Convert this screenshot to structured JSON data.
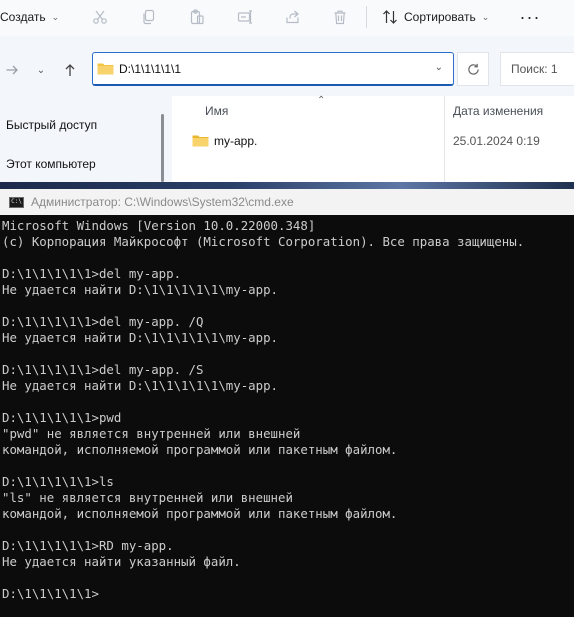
{
  "explorer": {
    "toolbar": {
      "create_label": "Создать",
      "sort_label": "Сортировать",
      "more_label": "···",
      "icons": [
        "cut-icon",
        "copy-icon",
        "paste-icon",
        "rename-icon",
        "share-icon",
        "delete-icon"
      ]
    },
    "address": {
      "path": "D:\\1\\1\\1\\1\\1"
    },
    "search": {
      "placeholder": "Поиск: 1"
    },
    "nav": {
      "items": [
        {
          "label": "Быстрый доступ"
        },
        {
          "label": "Этот компьютер"
        }
      ]
    },
    "columns": {
      "name": "Имя",
      "date": "Дата изменения"
    },
    "files": [
      {
        "name": "my-app.",
        "date": "25.01.2024 0:19"
      }
    ]
  },
  "cmd": {
    "title": "Администратор: C:\\Windows\\System32\\cmd.exe",
    "icon_text": "C:\\",
    "lines": [
      "Microsoft Windows [Version 10.0.22000.348]",
      "(c) Корпорация Майкрософт (Microsoft Corporation). Все права защищены.",
      "",
      "D:\\1\\1\\1\\1\\1>del my-app.",
      "Не удается найти D:\\1\\1\\1\\1\\1\\my-app.",
      "",
      "D:\\1\\1\\1\\1\\1>del my-app. /Q",
      "Не удается найти D:\\1\\1\\1\\1\\1\\my-app.",
      "",
      "D:\\1\\1\\1\\1\\1>del my-app. /S",
      "Не удается найти D:\\1\\1\\1\\1\\1\\my-app.",
      "",
      "D:\\1\\1\\1\\1\\1>pwd",
      "\"pwd\" не является внутренней или внешней",
      "командой, исполняемой программой или пакетным файлом.",
      "",
      "D:\\1\\1\\1\\1\\1>ls",
      "\"ls\" не является внутренней или внешней",
      "командой, исполняемой программой или пакетным файлом.",
      "",
      "D:\\1\\1\\1\\1\\1>RD my-app.",
      "Не удается найти указанный файл.",
      "",
      "D:\\1\\1\\1\\1\\1>"
    ]
  },
  "colors": {
    "console_bg": "#0c0c0c",
    "console_fg": "#cccccc",
    "accent": "#2d6ec9",
    "folder": "#f4c542"
  }
}
